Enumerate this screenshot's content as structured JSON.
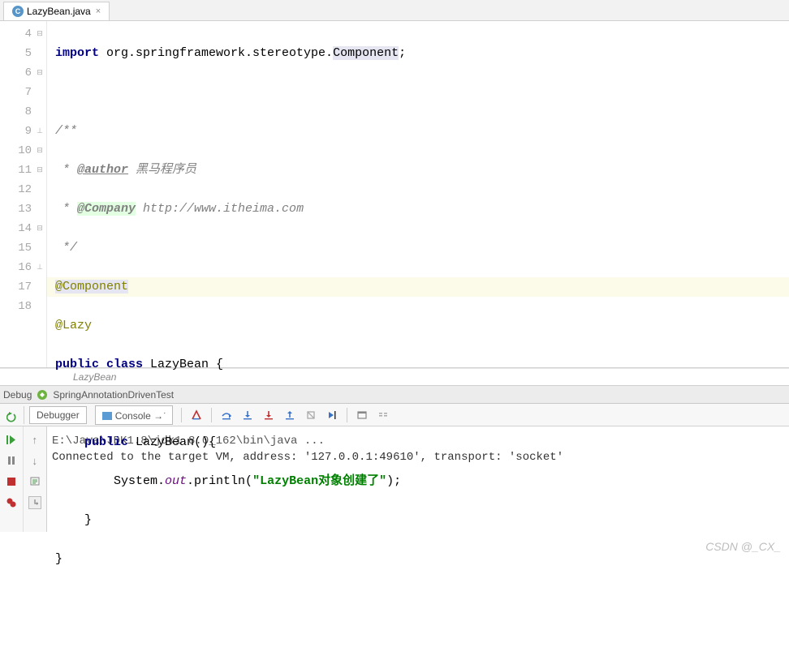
{
  "tab": {
    "icon_letter": "C",
    "filename": "LazyBean.java"
  },
  "gutter": {
    "start": 4,
    "end": 18
  },
  "code": {
    "l4": {
      "kw_import": "import",
      "pkg": " org.springframework.stereotype.",
      "cls": "Component",
      "semi": ";"
    },
    "l6": "/**",
    "l7": {
      "star": " * ",
      "tag": "@author",
      "rest": " 黑马程序员"
    },
    "l8": {
      "star": " * ",
      "tag": "@Company",
      "rest": " http://www.itheima.com"
    },
    "l9": " */",
    "l10": "@Component",
    "l11": "@Lazy",
    "l12": {
      "kw1": "public",
      "kw2": "class",
      "name": " LazyBean {"
    },
    "l14": {
      "kw": "public",
      "rest": " LazyBean(){"
    },
    "l15": {
      "pre": "        System.",
      "out": "out",
      "mid": ".println(",
      "str": "\"LazyBean对象创建了\"",
      "post": ");"
    },
    "l16": "    }",
    "l17": "}"
  },
  "breadcrumb": "LazyBean",
  "debug": {
    "label": "Debug",
    "config": "SpringAnnotationDrivenTest"
  },
  "toolbar": {
    "debugger": "Debugger",
    "console": "Console"
  },
  "console": {
    "line1": "E:\\Java\\JDK1.8\\jdk1.8.0_162\\bin\\java ...",
    "line2": "Connected to the target VM, address: '127.0.0.1:49610', transport: 'socket'"
  },
  "watermark": "CSDN @_CX_"
}
